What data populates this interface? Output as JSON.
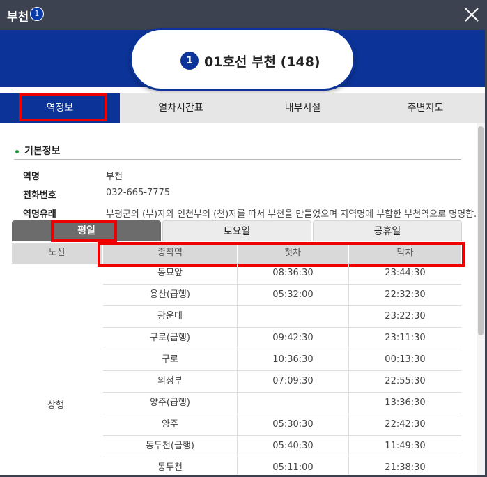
{
  "header": {
    "title": "부천",
    "badge": "1"
  },
  "station": {
    "line_number": "1",
    "line_name": "01호선 부천 (148)",
    "accent": "#0c3498"
  },
  "tabs": [
    {
      "label": "역정보",
      "active": true
    },
    {
      "label": "열차시간표",
      "active": false
    },
    {
      "label": "내부시설",
      "active": false
    },
    {
      "label": "주변지도",
      "active": false
    }
  ],
  "basic_info": {
    "title": "기본정보",
    "rows": [
      {
        "label": "역명",
        "value": "부천"
      },
      {
        "label": "전화번호",
        "value": "032-665-7775"
      },
      {
        "label": "역명유래",
        "value": "부평군의 (부)자와 인천부의 (천)자를 따서 부천을 만들었으며 지역명에 부합한 부천역으로 명명함."
      }
    ]
  },
  "day_tabs": [
    {
      "label": "평일",
      "active": true
    },
    {
      "label": "토요일",
      "active": false
    },
    {
      "label": "공휴일",
      "active": false
    }
  ],
  "timetable": {
    "headers": [
      "노선",
      "종착역",
      "첫차",
      "막차"
    ],
    "direction": "상행",
    "rows": [
      {
        "destination": "동묘앞",
        "first": "08:36:30",
        "last": "23:44:30"
      },
      {
        "destination": "용산(급행)",
        "first": "05:32:00",
        "last": "22:32:30"
      },
      {
        "destination": "광운대",
        "first": "",
        "last": "23:22:30"
      },
      {
        "destination": "구로(급행)",
        "first": "09:42:30",
        "last": "23:11:30"
      },
      {
        "destination": "구로",
        "first": "10:36:30",
        "last": "00:13:30"
      },
      {
        "destination": "의정부",
        "first": "07:09:30",
        "last": "22:55:30"
      },
      {
        "destination": "양주(급행)",
        "first": "",
        "last": "13:36:30"
      },
      {
        "destination": "양주",
        "first": "05:30:30",
        "last": "22:42:30"
      },
      {
        "destination": "동두천(급행)",
        "first": "05:40:30",
        "last": "11:49:30"
      },
      {
        "destination": "동두천",
        "first": "05:11:00",
        "last": "21:38:30"
      }
    ]
  }
}
